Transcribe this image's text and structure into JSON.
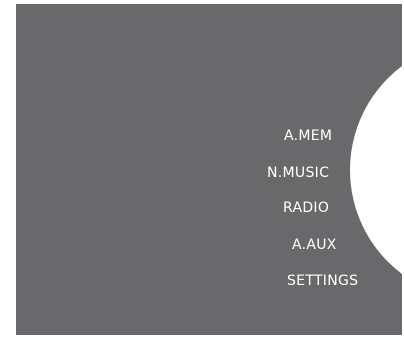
{
  "menu": {
    "items": [
      {
        "label": "A.MEM"
      },
      {
        "label": "N.MUSIC"
      },
      {
        "label": "RADIO"
      },
      {
        "label": "A.AUX"
      },
      {
        "label": "SETTINGS"
      }
    ]
  },
  "colors": {
    "background": "#69696c",
    "wheel": "#ffffff",
    "text": "#ffffff"
  }
}
